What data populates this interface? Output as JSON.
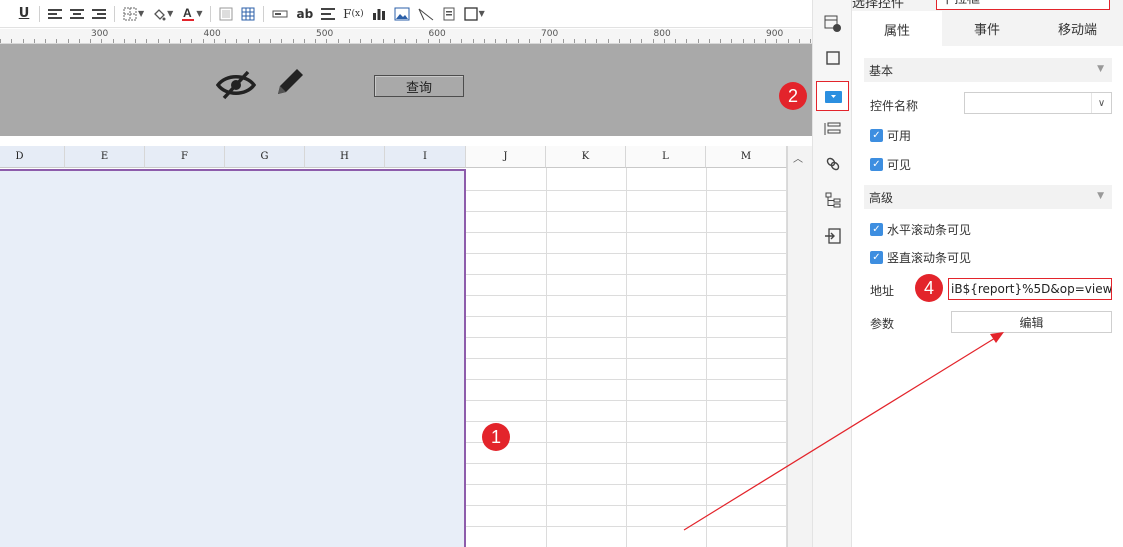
{
  "toolbar": {
    "items": [
      {
        "name": "underline-button",
        "glyph": "U̲"
      },
      {
        "name": "align-left-button",
        "glyph": "≡"
      },
      {
        "name": "align-center-button",
        "glyph": "≡"
      },
      {
        "name": "align-right-button",
        "glyph": "≡"
      },
      {
        "name": "border-button",
        "glyph": "▦"
      },
      {
        "name": "fill-color-button",
        "glyph": "⛀"
      },
      {
        "name": "font-color-button",
        "glyph": "A"
      },
      {
        "name": "merge-cell-button",
        "glyph": "▭"
      },
      {
        "name": "table-button",
        "glyph": "▦"
      },
      {
        "name": "text-field-button",
        "glyph": "▭"
      },
      {
        "name": "label-button",
        "glyph": "ab"
      },
      {
        "name": "list-button",
        "glyph": "☰"
      },
      {
        "name": "formula-button",
        "glyph": "Fx"
      },
      {
        "name": "chart-button",
        "glyph": "▮"
      },
      {
        "name": "image-button",
        "glyph": "▣"
      },
      {
        "name": "slash-button",
        "glyph": "⟍"
      },
      {
        "name": "sub-report-button",
        "glyph": "▤"
      },
      {
        "name": "frame-button",
        "glyph": "□"
      }
    ]
  },
  "ruler": {
    "labels": [
      "300",
      "400",
      "500",
      "600",
      "700",
      "800",
      "900"
    ]
  },
  "parameter_panel": {
    "query_button": "查询"
  },
  "sheet": {
    "columns": [
      "D",
      "E",
      "F",
      "G",
      "H",
      "I",
      "J",
      "K",
      "L",
      "M"
    ]
  },
  "properties": {
    "top_label": "选择控件",
    "top_value": "下拉框",
    "tabs": [
      "属性",
      "事件",
      "移动端"
    ],
    "basic": {
      "title": "基本",
      "widget_name_label": "控件名称",
      "enabled_label": "可用",
      "visible_label": "可见"
    },
    "advanced": {
      "title": "高级",
      "hscroll_label": "水平滚动条可见",
      "vscroll_label": "竖直滚动条可见",
      "url_label": "地址",
      "url_value": "iB${report}%5D&op=view",
      "params_label": "参数",
      "edit_button": "编辑"
    }
  },
  "callouts": [
    "1",
    "2",
    "4"
  ],
  "colors": {
    "accent": "#e3242b",
    "check": "#3d8ee0",
    "selection_border": "#8d5cab",
    "panel_gray": "#a9a9a9"
  }
}
